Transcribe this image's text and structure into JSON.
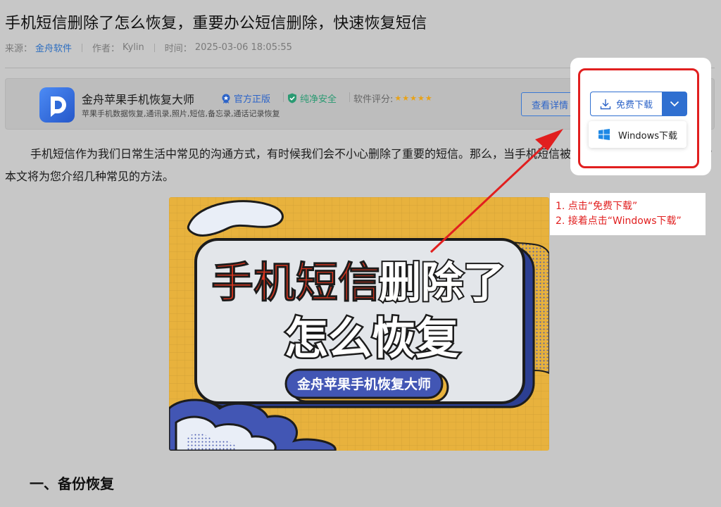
{
  "article": {
    "title": "手机短信删除了怎么恢复，重要办公短信删除，快速恢复短信",
    "meta": {
      "source_label": "来源：",
      "source_value": "金舟软件",
      "author_label": "作者：",
      "author_value": "Kylin",
      "time_label": "时间：",
      "time_value": "2025-03-06 18:05:55"
    },
    "intro_paragraph": "手机短信作为我们日常生活中常见的沟通方式，有时候我们会不小心删除了重要的短信。那么，当手机短信被删除后，我们该如何恢复呢？本文将为您介绍几种常见的方法。",
    "section_heading": "一、备份恢复"
  },
  "app_card": {
    "name": "金舟苹果手机恢复大师",
    "badge_official": "官方正版",
    "badge_safe": "纯净安全",
    "rating_label": "软件评分:",
    "rating_stars": 5,
    "stars_glyphs": "★★★★★",
    "description": "苹果手机数据恢复,通讯录,照片,短信,备忘录,通话记录恢复",
    "details_button": "查看详情"
  },
  "download": {
    "free_download_label": "免费下载",
    "windows_option": "Windows下载"
  },
  "banner": {
    "line1_red": "手机短信",
    "line1_white": "删除了",
    "line2": "怎么恢复",
    "pill": "金舟苹果手机恢复大师"
  },
  "annotation": {
    "step1": "1. 点击“免费下载”",
    "step2": "2. 接着点击“Windows下载”"
  },
  "colors": {
    "overlay_gray": "#c7c7c7",
    "link_blue": "#2d6ec0",
    "annotation_red": "#e11f1f",
    "safe_green": "#2a9a72",
    "star_gold": "#e8a217",
    "banner_yellow": "#e8b23d",
    "banner_navy": "#2c3f92"
  }
}
